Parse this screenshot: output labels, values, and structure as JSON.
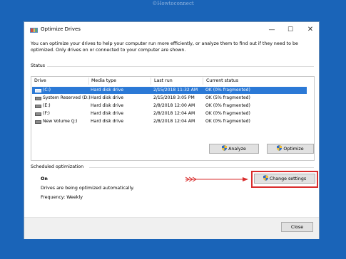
{
  "watermark": "©Howtoconnect",
  "window": {
    "title": "Optimize Drives",
    "minimize_glyph": "—",
    "maximize_glyph": "☐",
    "close_glyph": "✕"
  },
  "description": "You can optimize your drives to help your computer run more efficiently, or analyze them to find out if they need to be optimized. Only drives on or connected to your computer are shown.",
  "status_section": {
    "label": "Status",
    "columns": [
      "Drive",
      "Media type",
      "Last run",
      "Current status"
    ],
    "rows": [
      {
        "drive": "(C:)",
        "media": "Hard disk drive",
        "last_run": "2/15/2018 11:32 AM",
        "status": "OK (0% fragmented)",
        "selected": true
      },
      {
        "drive": "System Reserved (D:)",
        "media": "Hard disk drive",
        "last_run": "2/15/2018 3:05 PM",
        "status": "OK (5% fragmented)",
        "selected": false
      },
      {
        "drive": "(E:)",
        "media": "Hard disk drive",
        "last_run": "2/8/2018 12:00 AM",
        "status": "OK (0% fragmented)",
        "selected": false
      },
      {
        "drive": "(F:)",
        "media": "Hard disk drive",
        "last_run": "2/8/2018 12:04 AM",
        "status": "OK (0% fragmented)",
        "selected": false
      },
      {
        "drive": "New Volume (J:)",
        "media": "Hard disk drive",
        "last_run": "2/8/2018 12:04 AM",
        "status": "OK (0% fragmented)",
        "selected": false
      }
    ]
  },
  "buttons": {
    "analyze": "Analyze",
    "optimize": "Optimize",
    "change_settings": "Change settings",
    "close": "Close"
  },
  "scheduled": {
    "label": "Scheduled optimization",
    "state": "On",
    "description": "Drives are being optimized automatically.",
    "frequency": "Frequency: Weekly"
  },
  "icons": {
    "window": "defrag-icon",
    "drive": "hard-drive-icon",
    "button": "uac-shield-icon"
  },
  "colors": {
    "desktop": "#1a64b8",
    "selection": "#2b79d6",
    "annotation": "#d92c2c"
  }
}
